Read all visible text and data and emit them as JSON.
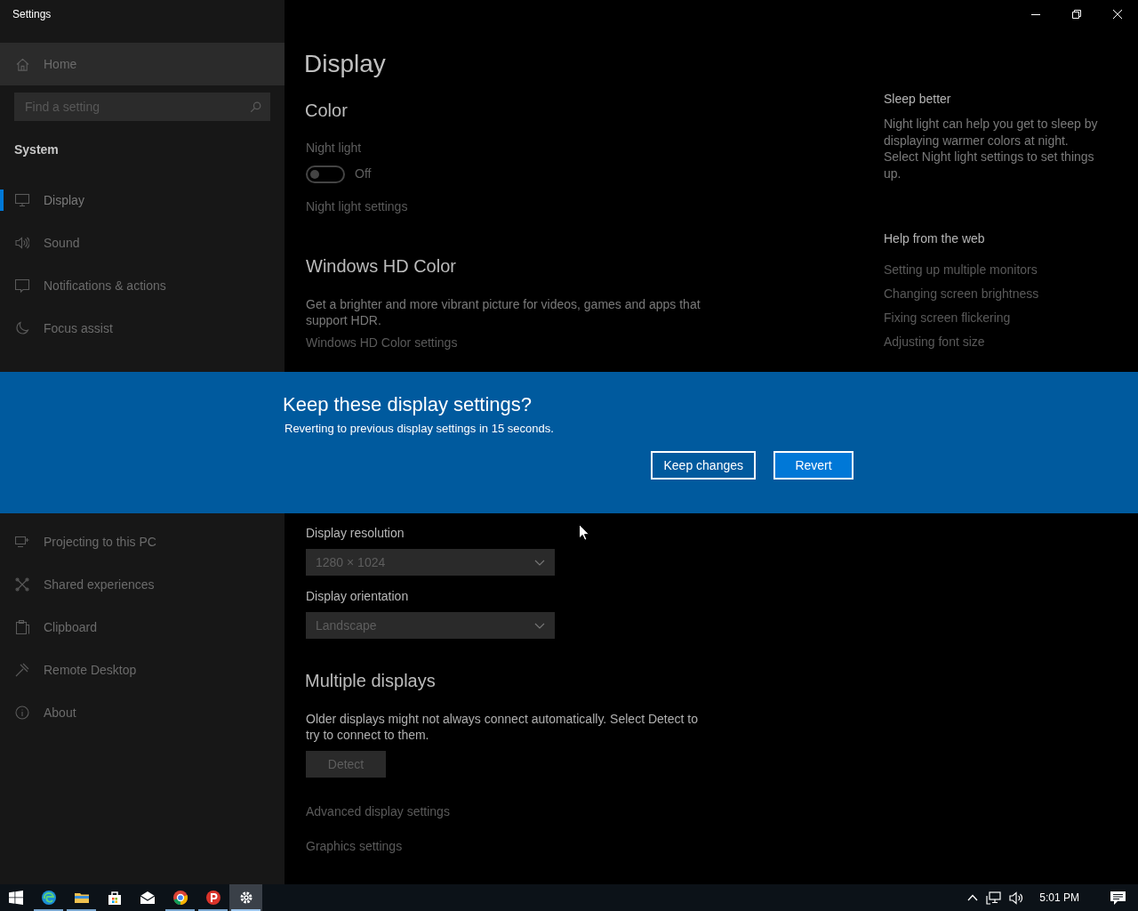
{
  "window": {
    "title": "Settings",
    "controls": [
      {
        "kind": "minimize"
      },
      {
        "kind": "restore"
      },
      {
        "kind": "close"
      }
    ]
  },
  "sidebar_upper": {
    "home": "Home",
    "search": {
      "placeholder": "Find a setting"
    },
    "section": "System",
    "items": [
      {
        "label": "Display",
        "kind": "display",
        "selected": true
      },
      {
        "label": "Sound",
        "kind": "sound",
        "selected": false
      },
      {
        "label": "Notifications & actions",
        "kind": "notifications",
        "selected": false
      },
      {
        "label": "Focus assist",
        "kind": "focus",
        "selected": false
      }
    ]
  },
  "page": {
    "title": "Display",
    "color_heading": "Color",
    "night_light": {
      "label": "Night light",
      "on": false,
      "state_text": "Off",
      "link": "Night light settings"
    },
    "hd_color": {
      "heading": "Windows HD Color",
      "description": "Get a brighter and more vibrant picture for videos, games and apps that support HDR.",
      "link": "Windows HD Color settings"
    }
  },
  "aside": {
    "tip_heading": "Sleep better",
    "tip_text": "Night light can help you get to sleep by displaying warmer colors at night. Select Night light settings to set things up.",
    "help_heading": "Help from the web",
    "help_links": [
      "Setting up multiple monitors",
      "Changing screen brightness",
      "Fixing screen flickering",
      "Adjusting font size"
    ]
  },
  "dialog": {
    "title": "Keep these display settings?",
    "message": "Reverting to previous display settings in 15 seconds.",
    "buttons": [
      {
        "label": "Keep changes",
        "selected": false
      },
      {
        "label": "Revert",
        "selected": true
      }
    ]
  },
  "sidebar_lower": {
    "items": [
      {
        "label": "Projecting to this PC",
        "kind": "projecting",
        "selected": false
      },
      {
        "label": "Shared experiences",
        "kind": "shared",
        "selected": false
      },
      {
        "label": "Clipboard",
        "kind": "clipboard",
        "selected": false
      },
      {
        "label": "Remote Desktop",
        "kind": "remote",
        "selected": false
      },
      {
        "label": "About",
        "kind": "about",
        "selected": false
      }
    ]
  },
  "page_lower": {
    "resolution": {
      "label": "Display resolution",
      "value": "1280 × 1024"
    },
    "orientation": {
      "label": "Display orientation",
      "value": "Landscape"
    },
    "multiple": {
      "heading": "Multiple displays",
      "description": "Older displays might not always connect automatically. Select Detect to try to connect to them.",
      "button": "Detect"
    },
    "links": [
      "Advanced display settings",
      "Graphics settings"
    ]
  },
  "taskbar": {
    "apps": [
      {
        "kind": "edge",
        "running": true,
        "selected": false
      },
      {
        "kind": "explorer",
        "running": true,
        "selected": false
      },
      {
        "kind": "store",
        "running": false,
        "selected": false
      },
      {
        "kind": "mail",
        "running": false,
        "selected": false
      },
      {
        "kind": "chrome",
        "running": true,
        "selected": false
      },
      {
        "kind": "p-app",
        "running": true,
        "selected": false
      },
      {
        "kind": "settings",
        "running": true,
        "selected": true
      }
    ],
    "time": "5:01 PM"
  }
}
